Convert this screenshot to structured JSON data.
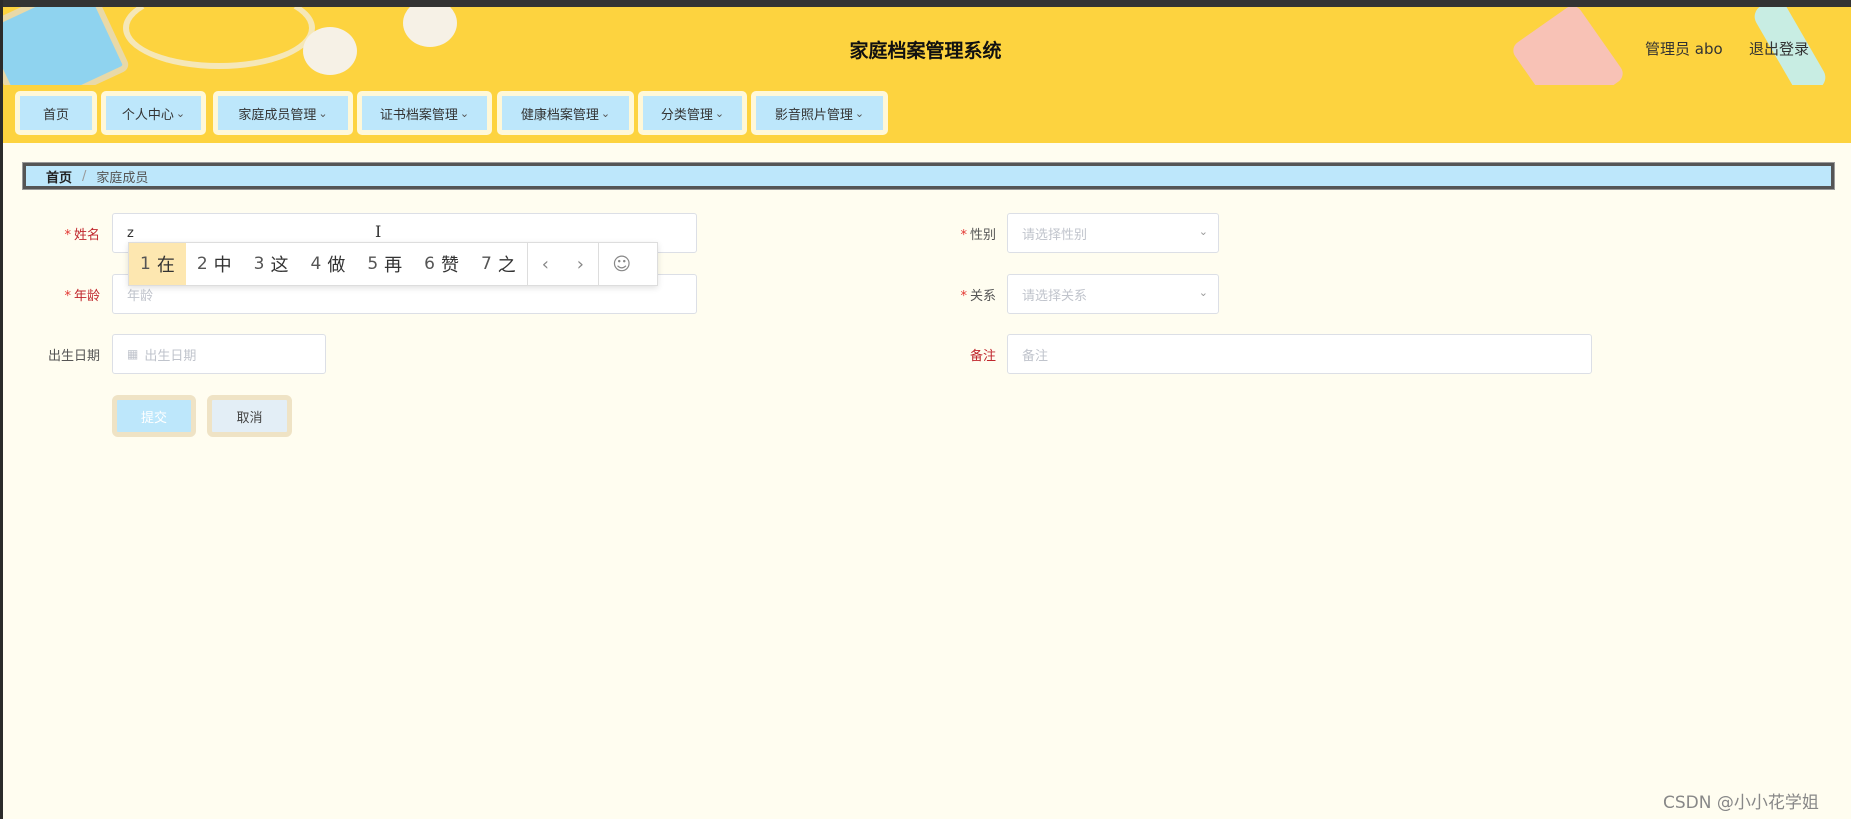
{
  "header": {
    "title": "家庭档案管理系统",
    "user_label": "管理员 abo",
    "logout_label": "退出登录"
  },
  "nav": {
    "items": [
      {
        "label": "首页",
        "dropdown": false
      },
      {
        "label": "个人中心",
        "dropdown": true
      },
      {
        "label": "家庭成员管理",
        "dropdown": true
      },
      {
        "label": "证书档案管理",
        "dropdown": true
      },
      {
        "label": "健康档案管理",
        "dropdown": true
      },
      {
        "label": "分类管理",
        "dropdown": true
      },
      {
        "label": "影音照片管理",
        "dropdown": true
      }
    ]
  },
  "breadcrumb": {
    "home": "首页",
    "separator": "/",
    "current": "家庭成员"
  },
  "form": {
    "name": {
      "label": "姓名",
      "required": true,
      "value": "z"
    },
    "gender": {
      "label": "性别",
      "required": true,
      "placeholder": "请选择性别"
    },
    "age": {
      "label": "年龄",
      "required": true,
      "placeholder": "年龄"
    },
    "relation": {
      "label": "关系",
      "required": true,
      "placeholder": "请选择关系"
    },
    "birthday": {
      "label": "出生日期",
      "required": false,
      "placeholder": "出生日期"
    },
    "remark": {
      "label": "备注",
      "required": false,
      "placeholder": "备注"
    },
    "submit_label": "提交",
    "cancel_label": "取消"
  },
  "ime": {
    "candidates": [
      {
        "num": "1",
        "char": "在"
      },
      {
        "num": "2",
        "char": "中"
      },
      {
        "num": "3",
        "char": "这"
      },
      {
        "num": "4",
        "char": "做"
      },
      {
        "num": "5",
        "char": "再"
      },
      {
        "num": "6",
        "char": "赞"
      },
      {
        "num": "7",
        "char": "之"
      }
    ],
    "prev": "‹",
    "next": "›",
    "emoji": "☺"
  },
  "icons": {
    "chevron": "chevron-down-icon",
    "calendar": "calendar-icon"
  },
  "colors": {
    "header_bg": "#fdd33f",
    "nav_button_bg": "#bde7fb",
    "page_bg": "#fffdf0",
    "required": "#e3342f"
  },
  "watermark": "CSDN @小小花学姐"
}
